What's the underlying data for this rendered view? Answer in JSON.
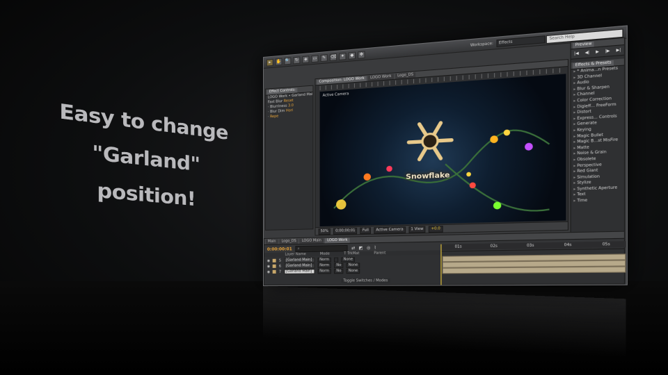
{
  "tagline": {
    "lines": [
      "Easy to change",
      "\"Garland\"",
      "position!"
    ]
  },
  "toolbar": {
    "tools": [
      "▸",
      "✋",
      "🔍",
      "↻",
      "◈",
      "▭",
      "✎",
      "⌫",
      "✦",
      "◆",
      "✥"
    ],
    "workspace_label": "Workspace:",
    "workspace_value": "Effects",
    "search_placeholder": "Search Help"
  },
  "left_panel": {
    "tab": "Effect Controls:",
    "breadcrumb": "LOGO Work • Garland Main",
    "rows": [
      {
        "label": "Fast Blur",
        "value": "Reset"
      },
      {
        "label": "Blurriness",
        "value": "3.0"
      },
      {
        "label": "Blur Dim",
        "value": "Hori"
      },
      {
        "label": "",
        "value": "Repe"
      }
    ]
  },
  "comp": {
    "tab": "Composition: LOGO Work",
    "subtabs": [
      "LOGO Work",
      "Logo_DS"
    ],
    "viewer_label": "Active Camera",
    "title_text": "Snowflake",
    "zoom": "50%",
    "timecode": "0;00;00;01",
    "resolution": "Full",
    "camera": "Active Camera",
    "views": "1 View",
    "exposure": "+0.0"
  },
  "right_panel": {
    "preview_tab": "Preview",
    "preview_controls": [
      "|◀",
      "◀|",
      "▶",
      "|▶",
      "▶|"
    ],
    "effects_tab": "Effects & Presets",
    "effects": [
      "* Anima...n Presets",
      "3D Channel",
      "Audio",
      "Blur & Sharpen",
      "Channel",
      "Color Correction",
      "Digieff... FreeForm",
      "Distort",
      "Express... Controls",
      "Generate",
      "Keying",
      "Magic Bullet",
      "Magic B...st MisFire",
      "Matte",
      "Noise & Grain",
      "Obsolete",
      "Perspective",
      "Red Giant",
      "Simulation",
      "Stylize",
      "Synthetic Aperture",
      "Text",
      "Time"
    ]
  },
  "timeline": {
    "tabs": [
      "Main",
      "Logo_DS",
      "LOGO Main",
      "LOGO Work"
    ],
    "timecode": "0:00:00:01",
    "ruler": [
      "01s",
      "02s",
      "03s",
      "04s",
      "05s"
    ],
    "columns": [
      "Layer Name",
      "Mode",
      "T TrkMat",
      "Parent"
    ],
    "layers": [
      {
        "index": "5",
        "name": "[Garland Main]",
        "mode": "Norm",
        "trkmat": "",
        "parent": "None",
        "selected": false
      },
      {
        "index": "6",
        "name": "[Garland Main]",
        "mode": "Norm",
        "trkmat": "No",
        "parent": "None",
        "selected": false
      },
      {
        "index": "7",
        "name": "[Garland Main]",
        "mode": "Norm",
        "trkmat": "No",
        "parent": "None",
        "selected": true
      }
    ],
    "footer": "Toggle Switches / Modes"
  }
}
